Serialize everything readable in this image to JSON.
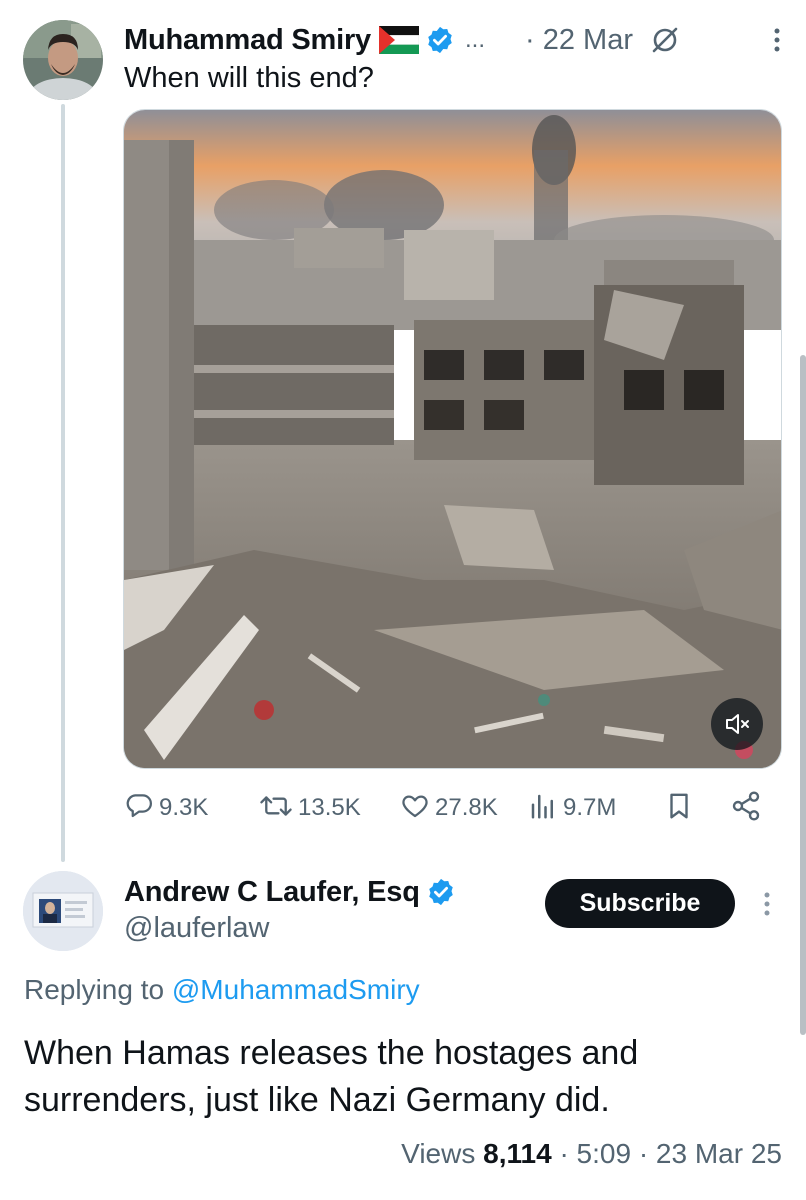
{
  "main_post": {
    "author_name": "Muhammad Smiry",
    "ellipsis": "...",
    "date": "· 22 Mar",
    "text": "When will this end?",
    "media_type": "video",
    "actions": {
      "replies": "9.3K",
      "reposts": "13.5K",
      "likes": "27.8K",
      "views": "9.7M"
    }
  },
  "reply_post": {
    "author_name": "Andrew C Laufer, Esq",
    "handle": "@lauferlaw",
    "subscribe_label": "Subscribe",
    "replying_to_prefix": "Replying to",
    "replying_to_mention": "@MuhammadSmiry",
    "text": "When Hamas releases the hostages and surrenders, just like Nazi Germany did.",
    "views_label": "Views",
    "views_count": "8,114",
    "time_date": "· 5:09 · 23 Mar 25"
  },
  "colors": {
    "accent": "#1d9bf0",
    "text_primary": "#0f1419",
    "text_secondary": "#536471",
    "button_dark": "#0f1419"
  },
  "icons": {
    "reply": "speech-bubble-icon",
    "repost": "repost-arrows-icon",
    "like": "heart-icon",
    "views": "bar-chart-icon",
    "bookmark": "bookmark-icon",
    "share": "share-icon",
    "verified": "verified-badge-icon",
    "flag": "palestine-flag-icon",
    "grok": "grok-icon",
    "more": "vertical-dots-icon",
    "mute": "muted-speaker-icon"
  }
}
